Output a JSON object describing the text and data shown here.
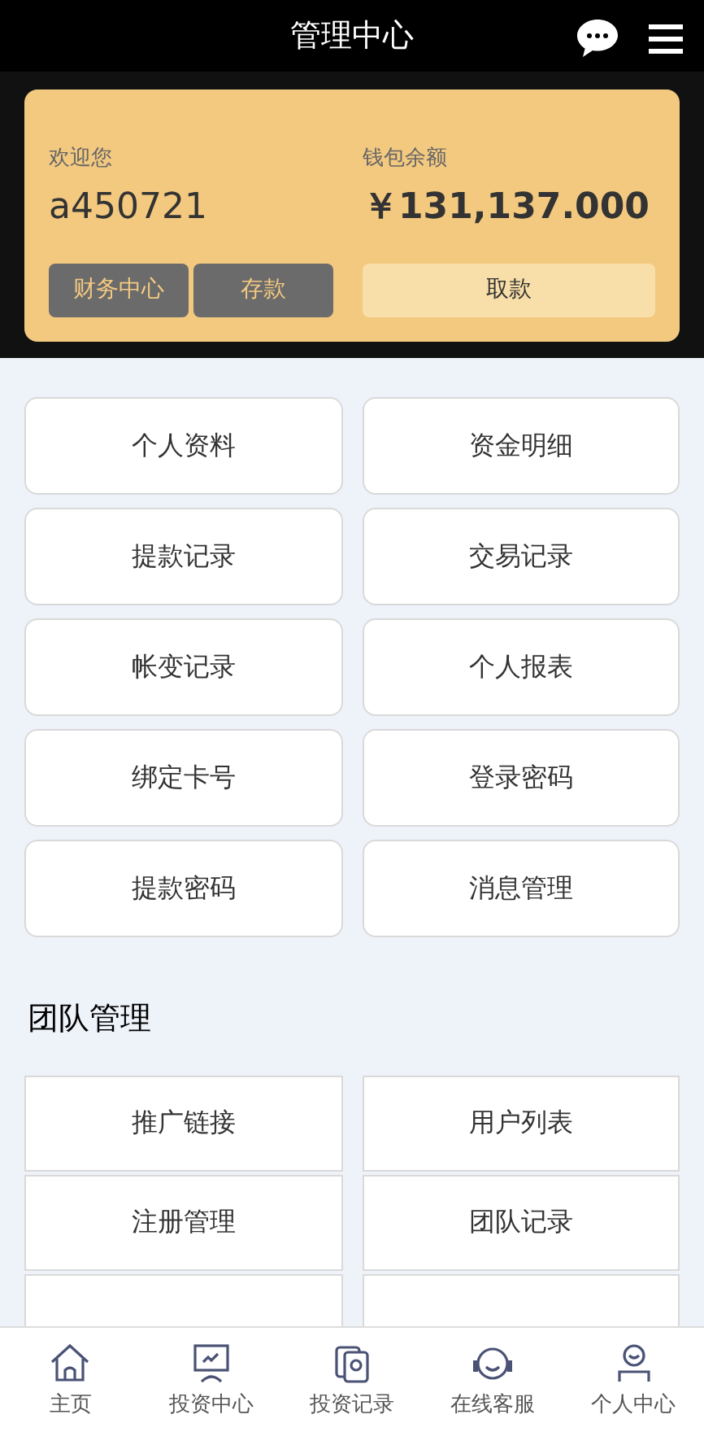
{
  "header": {
    "title": "管理中心"
  },
  "wallet": {
    "welcome_label": "欢迎您",
    "username": "a450721",
    "balance_label": "钱包余额",
    "balance": "￥131,137.000",
    "buttons": [
      {
        "label": "财务中心",
        "kind": "dark"
      },
      {
        "label": "存款",
        "kind": "dark"
      },
      {
        "label": "取款",
        "kind": "light"
      }
    ]
  },
  "menu": [
    "个人资料",
    "资金明细",
    "提款记录",
    "交易记录",
    "帐变记录",
    "个人报表",
    "绑定卡号",
    "登录密码",
    "提款密码",
    "消息管理"
  ],
  "team": {
    "title": "团队管理",
    "items": [
      "推广链接",
      "用户列表",
      "注册管理",
      "团队记录"
    ]
  },
  "tab_bar": [
    {
      "label": "主页",
      "kind": "home"
    },
    {
      "label": "投资中心",
      "kind": "monitor"
    },
    {
      "label": "投资记录",
      "kind": "cards"
    },
    {
      "label": "在线客服",
      "kind": "headset"
    },
    {
      "label": "个人中心",
      "kind": "person"
    }
  ]
}
